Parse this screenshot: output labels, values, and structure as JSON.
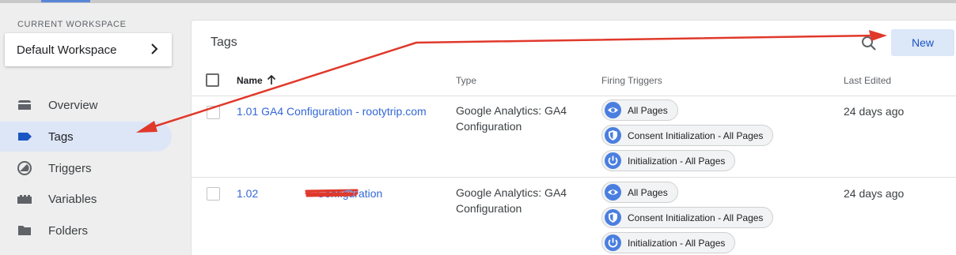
{
  "sidebar": {
    "workspace_label": "CURRENT WORKSPACE",
    "workspace_name": "Default Workspace",
    "items": [
      {
        "label": "Overview",
        "icon": "overview-icon"
      },
      {
        "label": "Tags",
        "icon": "tag-icon",
        "active": true
      },
      {
        "label": "Triggers",
        "icon": "trigger-icon"
      },
      {
        "label": "Variables",
        "icon": "variables-icon"
      },
      {
        "label": "Folders",
        "icon": "folder-icon"
      }
    ]
  },
  "main": {
    "title": "Tags",
    "new_button": "New",
    "columns": [
      "Name",
      "Type",
      "Firing Triggers",
      "Last Edited"
    ],
    "rows": [
      {
        "name": "1.01 GA4 Configuration - rootytrip.com",
        "type": "Google Analytics: GA4 Configuration",
        "triggers": [
          {
            "label": "All Pages",
            "icon": "eye-icon"
          },
          {
            "label": "Consent Initialization - All Pages",
            "icon": "shield-icon"
          },
          {
            "label": "Initialization - All Pages",
            "icon": "power-icon"
          }
        ],
        "last_edited": "24 days ago"
      },
      {
        "name_prefix": "1.02",
        "name_suffix": "Configuration",
        "type": "Google Analytics: GA4 Configuration",
        "triggers": [
          {
            "label": "All Pages",
            "icon": "eye-icon"
          },
          {
            "label": "Consent Initialization - All Pages",
            "icon": "shield-icon"
          },
          {
            "label": "Initialization - All Pages",
            "icon": "power-icon"
          }
        ],
        "last_edited": "24 days ago"
      }
    ]
  },
  "colors": {
    "accent": "#3367d6",
    "active_nav_bg": "#dde6f7",
    "annotation_arrow": "#e0392b",
    "chip_icon": "#4a7fe0"
  }
}
